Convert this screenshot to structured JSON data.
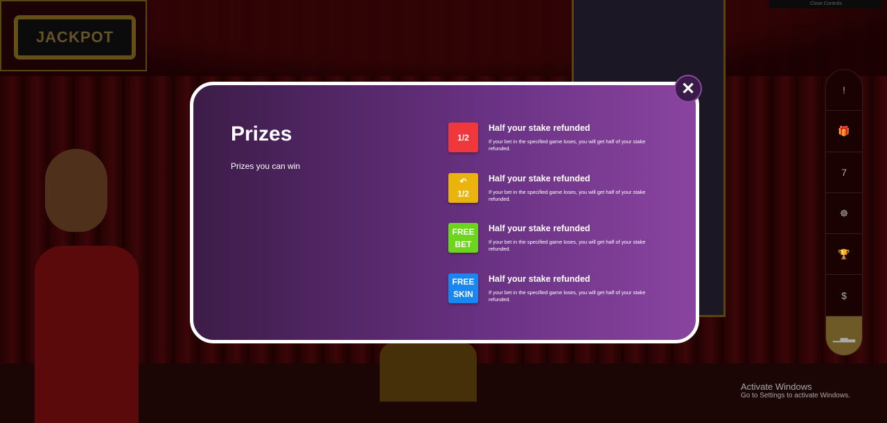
{
  "top_bar": {
    "close_controls": "Close Controls"
  },
  "logo": {
    "text": "JACKPOT"
  },
  "side_rail": {
    "items": [
      {
        "icon": "alert-icon",
        "glyph": "!"
      },
      {
        "icon": "gift-icon",
        "glyph": "🎁"
      },
      {
        "icon": "seven-icon",
        "glyph": "7"
      },
      {
        "icon": "ferris-wheel-icon",
        "glyph": "☸"
      },
      {
        "icon": "trophy-icon",
        "glyph": "🏆"
      },
      {
        "icon": "dollar-coin-icon",
        "glyph": "$"
      },
      {
        "icon": "podium-icon",
        "glyph": "▁▃▂",
        "active": true
      }
    ]
  },
  "modal": {
    "title": "Prizes",
    "subtitle": "Prizes you can win",
    "close_glyph": "✕",
    "prizes": [
      {
        "badge_line1": "1/2",
        "badge_line2": "",
        "badge_color": "#f0373c",
        "title": "Half your stake refunded",
        "description": "If your bet in the specified game loses, you will get half of your stake refunded."
      },
      {
        "badge_line1": "↶",
        "badge_line2": "1/2",
        "badge_color": "#eab40c",
        "title": "Half your stake refunded",
        "description": "If your bet in the specified game loses, you will get half of your stake refunded."
      },
      {
        "badge_line1": "FREE",
        "badge_line2": "BET",
        "badge_color": "#6cd61c",
        "title": "Half your stake refunded",
        "description": "If your bet in the specified game loses, you will get half of your stake refunded."
      },
      {
        "badge_line1": "FREE",
        "badge_line2": "SKIN",
        "badge_color": "#1a86f0",
        "title": "Half your stake refunded",
        "description": "If your bet in the specified game loses, you will get half of your stake refunded."
      }
    ]
  },
  "windows_watermark": {
    "line1": "Activate Windows",
    "line2": "Go to Settings to activate Windows."
  }
}
